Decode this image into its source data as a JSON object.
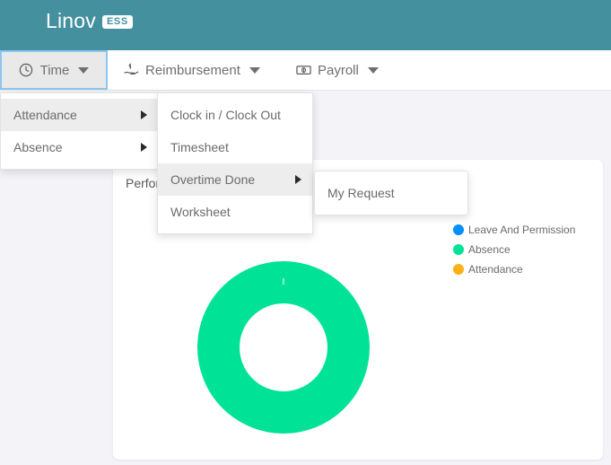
{
  "header": {
    "brand_name": "Linov",
    "brand_badge": "ESS",
    "background_color": "#45909f"
  },
  "navbar": {
    "items": [
      {
        "label": "Time",
        "icon": "clock-icon",
        "active": true,
        "has_caret": true
      },
      {
        "label": "Reimbursement",
        "icon": "hand-money-icon",
        "active": false,
        "has_caret": true
      },
      {
        "label": "Payroll",
        "icon": "banknote-icon",
        "active": false,
        "has_caret": true
      }
    ]
  },
  "menus": {
    "level1": {
      "items": [
        {
          "label": "Attendance",
          "has_submenu": true,
          "highlighted": true
        },
        {
          "label": "Absence",
          "has_submenu": true,
          "highlighted": false
        }
      ]
    },
    "level2": {
      "items": [
        {
          "label": "Clock in / Clock Out",
          "has_submenu": false,
          "highlighted": false
        },
        {
          "label": "Timesheet",
          "has_submenu": false,
          "highlighted": false
        },
        {
          "label": "Overtime Done",
          "has_submenu": true,
          "highlighted": true
        },
        {
          "label": "Worksheet",
          "has_submenu": false,
          "highlighted": false
        }
      ]
    },
    "level3": {
      "items": [
        {
          "label": "My Request",
          "has_submenu": false,
          "highlighted": false
        }
      ]
    }
  },
  "card": {
    "title": "Performance"
  },
  "chart_data": {
    "type": "pie",
    "variant": "donut",
    "title": "Performance",
    "labels": [
      "Leave And Permission",
      "Absence",
      "Attendance"
    ],
    "values": [
      0,
      100,
      0
    ],
    "colors": [
      "#008FFB",
      "#00E396",
      "#FEB019"
    ],
    "legend_position": "right",
    "grid": false,
    "units": "percent"
  },
  "legend": {
    "items": [
      {
        "label": "Leave And Permission",
        "color": "#008FFB"
      },
      {
        "label": "Absence",
        "color": "#00E396"
      },
      {
        "label": "Attendance",
        "color": "#FEB019"
      }
    ]
  },
  "colors": {
    "page_background": "#f4f4f8",
    "card_background": "#ffffff",
    "accent_teal": "#45909f",
    "focus_ring": "#8ec6ef",
    "menu_highlight": "#ededed"
  }
}
